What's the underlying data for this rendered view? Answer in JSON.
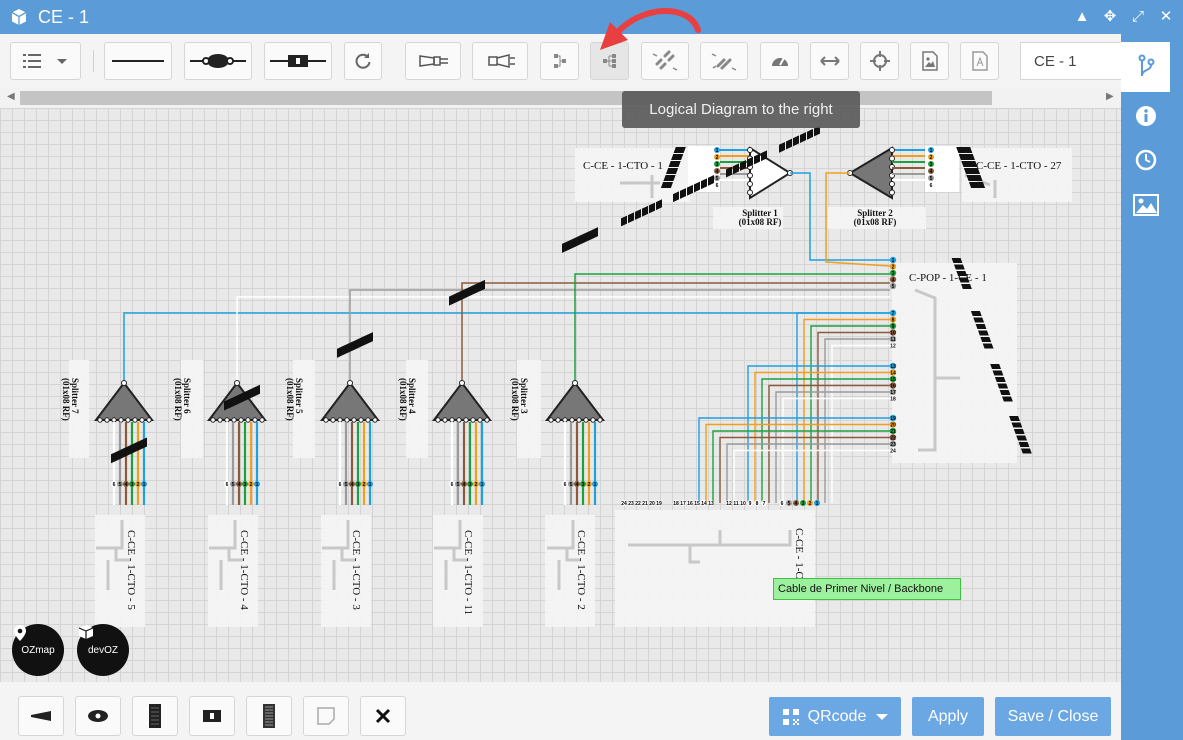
{
  "window": {
    "title": "CE - 1"
  },
  "toolbar": {
    "name_input_value": "CE - 1",
    "tooltip": "Logical Diagram to the right"
  },
  "diagram": {
    "splitter_top_1": {
      "name": "Splitter 1",
      "type": "(01x08 RF)"
    },
    "splitter_top_2": {
      "name": "Splitter 2",
      "type": "(01x08 RF)"
    },
    "cto_top_left": "C-CE - 1-CTO - 1",
    "cto_top_right": "C-CE - 1-CTO - 27",
    "pop_label": "C-POP - 1-CE - 1",
    "backbone_label": "Cable de Primer Nivel / Backbone",
    "bottom_splitters": [
      {
        "name": "Splitter 7",
        "type": "(01x08 RF)"
      },
      {
        "name": "Splitter 6",
        "type": "(01x08 RF)"
      },
      {
        "name": "Splitter 5",
        "type": "(01x08 RF)"
      },
      {
        "name": "Splitter 4",
        "type": "(01x08 RF)"
      },
      {
        "name": "Splitter 3",
        "type": "(01x08 RF)"
      }
    ],
    "bottom_ctos": [
      "C-CE - 1-CTO - 5",
      "C-CE - 1-CTO - 4",
      "C-CE - 1-CTO - 3",
      "C-CE - 1-CTO - 11",
      "C-CE - 1-CTO - 2"
    ],
    "ce_label": "C-CE - 1-CE - 2",
    "pop_ports_top": [
      "1",
      "2",
      "3",
      "4",
      "5"
    ],
    "pop_ports_mid1": [
      "7",
      "8",
      "9",
      "10",
      "11",
      "12"
    ],
    "pop_ports_mid2": [
      "13",
      "14",
      "15",
      "16",
      "17",
      "18"
    ],
    "pop_ports_bot": [
      "19",
      "20",
      "21",
      "22",
      "23",
      "24"
    ],
    "bottom_port_groups": [
      [
        "24",
        "23",
        "22",
        "21",
        "20",
        "19"
      ],
      [
        "18",
        "17",
        "16",
        "15",
        "14",
        "13"
      ],
      [
        "12",
        "11",
        "10",
        "9",
        "8",
        "7"
      ],
      [
        "6",
        "5",
        "4",
        "3",
        "2",
        "1"
      ]
    ],
    "fiber_colors": [
      "#1fa0e0",
      "#f0a020",
      "#1fa040",
      "#8b5a3c",
      "#9a9a9a",
      "#ffffff"
    ]
  },
  "logos": {
    "ozmap": "OZmap",
    "devoz": "devOZ"
  },
  "bottom": {
    "qrcode_label": "QRcode",
    "apply_label": "Apply",
    "save_label": "Save / Close"
  }
}
